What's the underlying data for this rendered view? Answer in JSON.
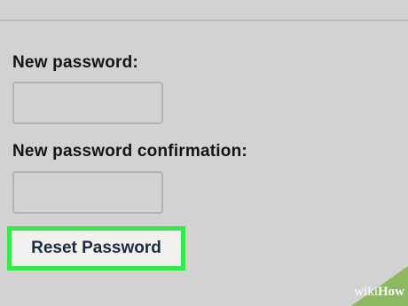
{
  "form": {
    "new_password_label": "New password:",
    "confirm_password_label": "New password confirmation:",
    "new_password_value": "",
    "confirm_password_value": "",
    "submit_label": "Reset Password"
  },
  "watermark": {
    "prefix": "wiki",
    "suffix": "How"
  },
  "colors": {
    "background": "#d2d2d2",
    "highlight": "#37e84b",
    "button_bg": "#f1f2f0",
    "button_text": "#1c2c3e",
    "watermark_green": "#8cb85f"
  }
}
